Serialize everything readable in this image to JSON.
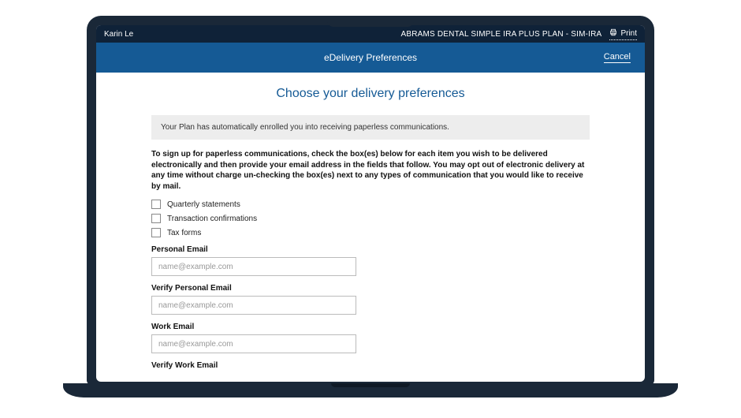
{
  "topbar": {
    "user_name": "Karin Le",
    "plan_name": "ABRAMS DENTAL SIMPLE IRA PLUS PLAN - SIM-IRA",
    "print_label": "Print"
  },
  "header": {
    "title": "eDelivery Preferences",
    "cancel_label": "Cancel"
  },
  "page": {
    "title": "Choose your delivery preferences",
    "notice": "Your Plan has automatically enrolled you into receiving paperless communications.",
    "description": "To sign up for paperless communications, check the box(es) below for each item you wish to be delivered electronically and then provide your email address in the fields that follow. You may opt out of electronic delivery at any time without charge un-checking the box(es) next to any types of communication that you would like to receive by mail."
  },
  "options": {
    "quarterly": "Quarterly statements",
    "transactions": "Transaction confirmations",
    "tax": "Tax forms"
  },
  "fields": {
    "personal_email_label": "Personal Email",
    "verify_personal_label": "Verify Personal Email",
    "work_email_label": "Work Email",
    "verify_work_label": "Verify Work Email",
    "placeholder": "name@example.com"
  }
}
